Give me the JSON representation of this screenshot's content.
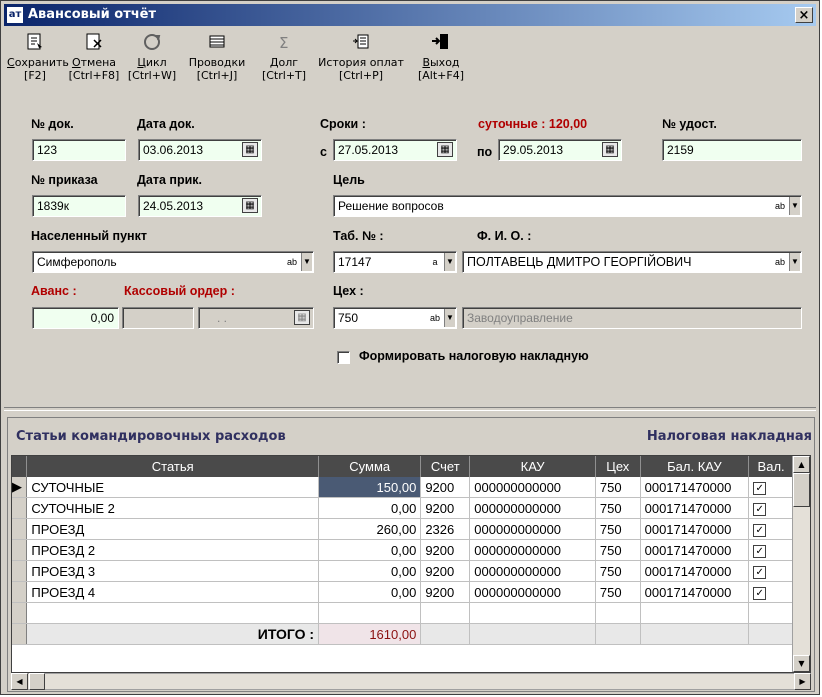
{
  "window": {
    "title": "Авансовый отчёт",
    "app_icon": "ат",
    "close": "×"
  },
  "toolbar": [
    {
      "icon": "save-icon",
      "label_u": "С",
      "label": "охранить",
      "key": "[F2]"
    },
    {
      "icon": "cancel-icon",
      "label_u": "О",
      "label": "тмена",
      "key": "[Ctrl+F8]"
    },
    {
      "icon": "cycle-icon",
      "label_u": "Ц",
      "label": "икл",
      "key": "[Ctrl+W]"
    },
    {
      "icon": "postings-icon",
      "label_u": "",
      "label": "Проводки",
      "key": "[Ctrl+J]"
    },
    {
      "icon": "sigma-icon",
      "label_u": "",
      "label": "Долг",
      "key": "[Ctrl+T]"
    },
    {
      "icon": "history-icon",
      "label_u": "",
      "label": "История оплат",
      "key": "[Ctrl+P]"
    },
    {
      "icon": "exit-icon",
      "label_u": "В",
      "label": "ыход",
      "key": "[Alt+F4]",
      "label_pre": ""
    }
  ],
  "form": {
    "doc_no_label": "№ док.",
    "doc_no": "123",
    "doc_date_label": "Дата док.",
    "doc_date": "03.06.2013",
    "terms_label": "Сроки :",
    "from_label": "с",
    "from_date": "27.05.2013",
    "to_label": "по",
    "to_date": "29.05.2013",
    "daily_label": "суточные : 120,00",
    "cert_label": "№ удост.",
    "cert_no": "2159",
    "order_no_label": "№ приказа",
    "order_no": "1839к",
    "order_date_label": "Дата прик.",
    "order_date": "24.05.2013",
    "purpose_label": "Цель",
    "purpose": "Решение вопросов",
    "city_label": "Населенный пункт",
    "city": "Симферополь",
    "tab_label": "Таб. № :",
    "tab_no": "17147",
    "fio_label": "Ф. И. О. :",
    "fio": "ПОЛТАВЕЦЬ ДМИТРО ГЕОРГІЙОВИЧ",
    "advance_label": "Аванс :",
    "advance": "0,00",
    "cash_order_label": "Кассовый ордер :",
    "cash_order_date": ". .",
    "shop_label": "Цех :",
    "shop_no": "750",
    "shop_name": "Заводоуправление",
    "tax_invoice_label": "Формировать налоговую накладную"
  },
  "panel": {
    "title": "Статьи командировочных расходов",
    "right_title": "Налоговая накладная"
  },
  "grid": {
    "columns": [
      "Статья",
      "Сумма",
      "Счет",
      "КАУ",
      "Цех",
      "Бал. КАУ",
      "Вал."
    ],
    "rows": [
      {
        "article": "СУТОЧНЫЕ",
        "sum": "150,00",
        "acct": "9200",
        "kau": "000000000000",
        "shop": "750",
        "bal": "000171470000",
        "val": "✓"
      },
      {
        "article": "СУТОЧНЫЕ 2",
        "sum": "0,00",
        "acct": "9200",
        "kau": "000000000000",
        "shop": "750",
        "bal": "000171470000",
        "val": "✓"
      },
      {
        "article": "ПРОЕЗД",
        "sum": "260,00",
        "acct": "2326",
        "kau": "000000000000",
        "shop": "750",
        "bal": "000171470000",
        "val": "✓"
      },
      {
        "article": "ПРОЕЗД 2",
        "sum": "0,00",
        "acct": "9200",
        "kau": "000000000000",
        "shop": "750",
        "bal": "000171470000",
        "val": "✓"
      },
      {
        "article": "ПРОЕЗД 3",
        "sum": "0,00",
        "acct": "9200",
        "kau": "000000000000",
        "shop": "750",
        "bal": "000171470000",
        "val": "✓"
      },
      {
        "article": "ПРОЕЗД 4",
        "sum": "0,00",
        "acct": "9200",
        "kau": "000000000000",
        "shop": "750",
        "bal": "000171470000",
        "val": "✓"
      }
    ],
    "total_label": "ИТОГО :",
    "total": "1610,00"
  }
}
